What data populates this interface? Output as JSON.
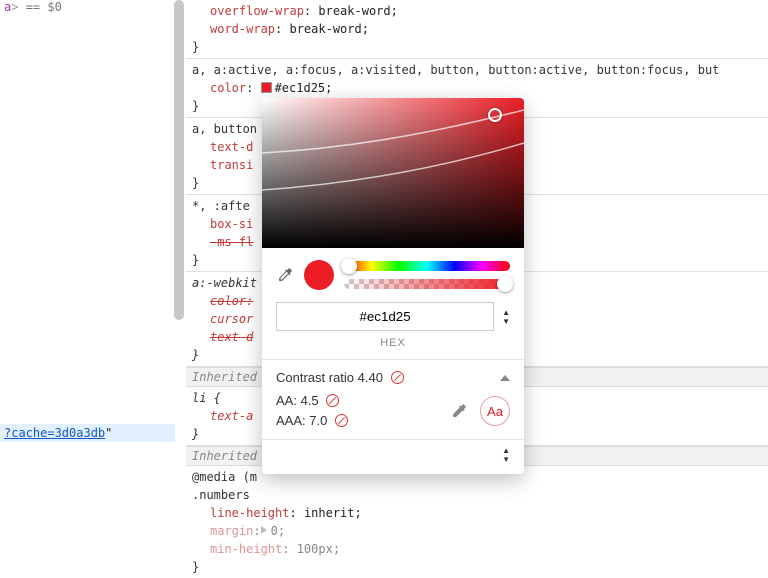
{
  "left_panel": {
    "selected_url": "?cache=3d0a3db",
    "closing_tag": "a",
    "eq_zero": " == $0"
  },
  "rules": [
    {
      "selectors_prefix": "",
      "props": [
        {
          "name": "overflow-wrap",
          "value": "break-word;",
          "strike": false
        },
        {
          "name": "word-wrap",
          "value": "break-word;",
          "strike": false
        }
      ],
      "close": "}"
    },
    {
      "selectors": "a, a:active, a:focus, a:visited, button, button:active, button:focus, but",
      "open": " {",
      "props": [
        {
          "name": "color",
          "swatch": "#ec1d25",
          "value": "#ec1d25;",
          "strike": false
        }
      ],
      "close": "}"
    },
    {
      "selectors": "a, button",
      "open": " {",
      "props": [
        {
          "name": "text-d",
          "value": "",
          "strike": false
        },
        {
          "name": "transi",
          "value": "",
          "strike": false
        }
      ],
      "close": "}"
    },
    {
      "selectors": "*, :afte",
      "open": "",
      "props": [
        {
          "name": "box-si",
          "value": "",
          "strike": false
        },
        {
          "name": "-ms-fl",
          "value": "",
          "strike": true
        }
      ],
      "close": "}"
    },
    {
      "selectors": "a:-webkit",
      "italic": true,
      "open": "",
      "props": [
        {
          "name": "color:",
          "value": "",
          "strike": true
        },
        {
          "name": "cursor",
          "value": "",
          "strike": false
        },
        {
          "name": "text-d",
          "value": "",
          "strike": true
        }
      ],
      "close": "}"
    }
  ],
  "inherited1_label": "Inherited f",
  "li_rule": {
    "selectors": "li {",
    "props": [
      {
        "name": "text-a",
        "value": ""
      }
    ],
    "close": "}"
  },
  "inherited2_label": "Inherited f",
  "media_rule": {
    "media": "@media (m",
    "selectors": ".numbers",
    "props_after": [
      {
        "name": "line-height",
        "value": "inherit;",
        "strike": false
      },
      {
        "name": "margin",
        "value": "0;",
        "expand": true,
        "strike": false,
        "dim": true
      },
      {
        "name": "min-height",
        "value": "100px;",
        "strike": false,
        "dim": true
      }
    ],
    "close": "}"
  },
  "picker": {
    "value": "#ec1d25",
    "format": "HEX",
    "contrast": {
      "title": "Contrast ratio",
      "ratio": "4.40",
      "aa_label": "AA:",
      "aa_value": "4.5",
      "aaa_label": "AAA:",
      "aaa_value": "7.0",
      "sample": "Aa"
    }
  }
}
